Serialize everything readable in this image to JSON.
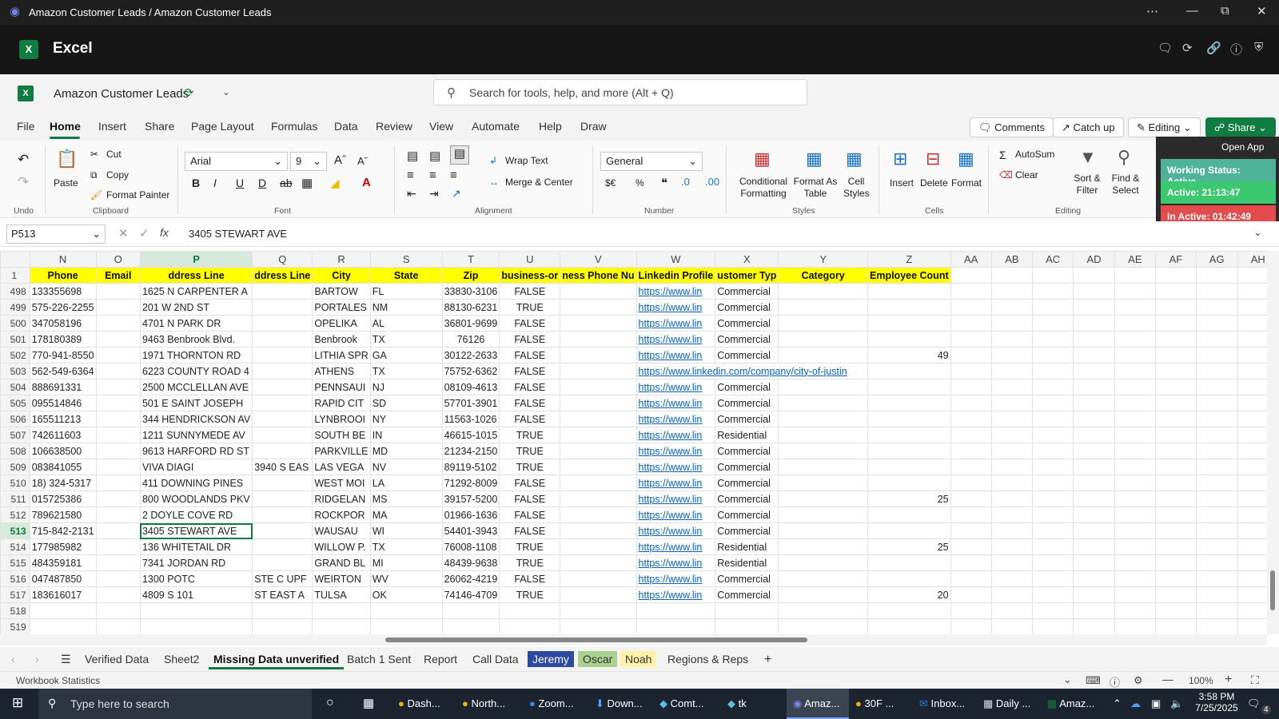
{
  "window": {
    "title": "Amazon Customer Leads / Amazon Customer Leads",
    "app_name": "Excel",
    "doc_name": "Amazon Customer Leads",
    "search_placeholder": "Search for tools, help, and more (Alt + Q)"
  },
  "menu": {
    "tabs": [
      "File",
      "Home",
      "Insert",
      "Share",
      "Page Layout",
      "Formulas",
      "Data",
      "Review",
      "View",
      "Automate",
      "Help",
      "Draw"
    ],
    "comments": "Comments",
    "catchup": "Catch up",
    "editing": "Editing",
    "share": "Share"
  },
  "ribbon": {
    "undo": "Undo",
    "clipboard": "Clipboard",
    "paste": "Paste",
    "cut": "Cut",
    "copy": "Copy",
    "format_painter": "Format Painter",
    "font": "Font",
    "font_name": "Arial",
    "font_size": "9",
    "alignment": "Alignment",
    "wrap_text": "Wrap Text",
    "merge_center": "Merge & Center",
    "number": "Number",
    "number_format": "General",
    "currency": "$€",
    "percent": "%",
    "styles": "Styles",
    "conditional_formatting": "Conditional Formatting",
    "format_as_table": "Format As Table",
    "cell_styles": "Cell Styles",
    "cells": "Cells",
    "insert": "Insert",
    "delete": "Delete",
    "format": "Format",
    "editing": "Editing",
    "autosum": "AutoSum",
    "clear": "Clear",
    "sort_filter": "Sort & Filter",
    "find_select": "Find & Select"
  },
  "overlay": {
    "open_app": "Open App",
    "working_status": "Working Status: Active",
    "active": "Active: 21:13:47",
    "inactive": "In Active: 01:42:49",
    "colors": {
      "working": "#4fb39a",
      "active": "#3cc870",
      "inactive": "#e24c4c"
    }
  },
  "formula": {
    "cell_ref": "P513",
    "fx": "fx",
    "value": "3405 STEWART AVE"
  },
  "grid": {
    "columns": [
      "N",
      "O",
      "P",
      "Q",
      "R",
      "S",
      "T",
      "U",
      "V",
      "W",
      "X",
      "Y",
      "Z",
      "AA",
      "AB",
      "AC",
      "AD",
      "AE",
      "AF",
      "AG",
      "AH"
    ],
    "header_row_num": "1",
    "headers": [
      "Phone",
      "Email",
      "ddress Line",
      "ddress Line",
      "City",
      "State",
      "Zip",
      "business-or",
      "ness Phone Nu",
      "Linkedin Profile",
      "ustomer Typ",
      "Category",
      "Employee Count"
    ],
    "rows": [
      {
        "n": "498",
        "phone": "133355698",
        "email": "",
        "addr1": "1625 N CARPENTER A",
        "addr2": "",
        "city": "BARTOW",
        "state": "FL",
        "zip": "33830-3106",
        "biz": "FALSE",
        "bphone": "",
        "li": "https://www.lin",
        "type": "Commercial",
        "cat": "",
        "emp": ""
      },
      {
        "n": "499",
        "phone": "575-226-2255",
        "email": "",
        "addr1": "201 W 2ND ST",
        "addr2": "",
        "city": "PORTALES",
        "state": "NM",
        "zip": "88130-6231",
        "biz": "TRUE",
        "bphone": "",
        "li": "https://www.lin",
        "type": "Commercial",
        "cat": "",
        "emp": ""
      },
      {
        "n": "500",
        "phone": "347058196",
        "email": "",
        "addr1": "4701 N PARK DR",
        "addr2": "",
        "city": "OPELIKA",
        "state": "AL",
        "zip": "36801-9699",
        "biz": "FALSE",
        "bphone": "",
        "li": "https://www.lin",
        "type": "Commercial",
        "cat": "",
        "emp": ""
      },
      {
        "n": "501",
        "phone": "178180389",
        "email": "",
        "addr1": "9463 Benbrook Blvd.",
        "addr2": "",
        "city": "Benbrook",
        "state": "TX",
        "zip": "76126",
        "biz": "FALSE",
        "bphone": "",
        "li": "https://www.lin",
        "type": "Commercial",
        "cat": "",
        "emp": ""
      },
      {
        "n": "502",
        "phone": "770-941-8550",
        "email": "",
        "addr1": "1971 THORNTON RD",
        "addr2": "",
        "city": "LITHIA SPR",
        "state": "GA",
        "zip": "30122-2633",
        "biz": "FALSE",
        "bphone": "",
        "li": "https://www.lin",
        "type": "Commercial",
        "cat": "",
        "emp": "49"
      },
      {
        "n": "503",
        "phone": "562-549-6364",
        "email": "",
        "addr1": "6223 COUNTY ROAD 4",
        "addr2": "",
        "city": "ATHENS",
        "state": "TX",
        "zip": "75752-6362",
        "biz": "FALSE",
        "bphone": "",
        "li": "https://www.linkedin.com/company/city-of-justin",
        "type": "",
        "cat": "",
        "emp": ""
      },
      {
        "n": "504",
        "phone": "888691331",
        "email": "",
        "addr1": "2500 MCCLELLAN AVE",
        "addr2": "",
        "city": "PENNSAUI",
        "state": "NJ",
        "zip": "08109-4613",
        "biz": "FALSE",
        "bphone": "",
        "li": "https://www.lin",
        "type": "Commercial",
        "cat": "",
        "emp": ""
      },
      {
        "n": "505",
        "phone": "095514846",
        "email": "",
        "addr1": "501 E SAINT JOSEPH",
        "addr2": "",
        "city": "RAPID CIT",
        "state": "SD",
        "zip": "57701-3901",
        "biz": "FALSE",
        "bphone": "",
        "li": "https://www.lin",
        "type": "Commercial",
        "cat": "",
        "emp": ""
      },
      {
        "n": "506",
        "phone": "165511213",
        "email": "",
        "addr1": "344 HENDRICKSON AV",
        "addr2": "",
        "city": "LYNBROOI",
        "state": "NY",
        "zip": "11563-1026",
        "biz": "FALSE",
        "bphone": "",
        "li": "https://www.lin",
        "type": "Commercial",
        "cat": "",
        "emp": ""
      },
      {
        "n": "507",
        "phone": "742611603",
        "email": "",
        "addr1": "1211 SUNNYMEDE AV",
        "addr2": "",
        "city": "SOUTH BE",
        "state": "IN",
        "zip": "46615-1015",
        "biz": "TRUE",
        "bphone": "",
        "li": "https://www.lin",
        "type": "Residential",
        "cat": "",
        "emp": ""
      },
      {
        "n": "508",
        "phone": "106638500",
        "email": "",
        "addr1": "9613 HARFORD RD ST",
        "addr2": "",
        "city": "PARKVILLE",
        "state": "MD",
        "zip": "21234-2150",
        "biz": "TRUE",
        "bphone": "",
        "li": "https://www.lin",
        "type": "Commercial",
        "cat": "",
        "emp": ""
      },
      {
        "n": "509",
        "phone": "083841055",
        "email": "",
        "addr1": "VIVA DIAGI",
        "addr2": "3940 S EAS",
        "city": "LAS VEGA",
        "state": "NV",
        "zip": "89119-5102",
        "biz": "TRUE",
        "bphone": "",
        "li": "https://www.lin",
        "type": "Commercial",
        "cat": "",
        "emp": ""
      },
      {
        "n": "510",
        "phone": "18) 324-5317",
        "email": "",
        "addr1": "411 DOWNING PINES",
        "addr2": "",
        "city": "WEST MOI",
        "state": "LA",
        "zip": "71292-8009",
        "biz": "FALSE",
        "bphone": "",
        "li": "https://www.lin",
        "type": "Commercial",
        "cat": "",
        "emp": ""
      },
      {
        "n": "511",
        "phone": "015725386",
        "email": "",
        "addr1": "800 WOODLANDS PKV",
        "addr2": "",
        "city": "RIDGELAN",
        "state": "MS",
        "zip": "39157-5200",
        "biz": "FALSE",
        "bphone": "",
        "li": "https://www.lin",
        "type": "Commercial",
        "cat": "",
        "emp": "25"
      },
      {
        "n": "512",
        "phone": "789621580",
        "email": "",
        "addr1": "2 DOYLE COVE RD",
        "addr2": "",
        "city": "ROCKPOR",
        "state": "MA",
        "zip": "01966-1636",
        "biz": "FALSE",
        "bphone": "",
        "li": "https://www.lin",
        "type": "Commercial",
        "cat": "",
        "emp": ""
      },
      {
        "n": "513",
        "phone": "715-842-2131",
        "email": "",
        "addr1": "3405 STEWART AVE",
        "addr2": "",
        "city": "WAUSAU",
        "state": "WI",
        "zip": "54401-3943",
        "biz": "FALSE",
        "bphone": "",
        "li": "https://www.lin",
        "type": "Commercial",
        "cat": "",
        "emp": ""
      },
      {
        "n": "514",
        "phone": "177985982",
        "email": "",
        "addr1": "136 WHITETAIL DR",
        "addr2": "",
        "city": "WILLOW P.",
        "state": "TX",
        "zip": "76008-1108",
        "biz": "TRUE",
        "bphone": "",
        "li": "https://www.lin",
        "type": "Residential",
        "cat": "",
        "emp": "25"
      },
      {
        "n": "515",
        "phone": "484359181",
        "email": "",
        "addr1": "7341 JORDAN RD",
        "addr2": "",
        "city": "GRAND BL",
        "state": "MI",
        "zip": "48439-9638",
        "biz": "TRUE",
        "bphone": "",
        "li": "https://www.lin",
        "type": "Residential",
        "cat": "",
        "emp": ""
      },
      {
        "n": "516",
        "phone": "047487850",
        "email": "",
        "addr1": "1300 POTC",
        "addr2": "STE C UPF",
        "city": "WEIRTON",
        "state": "WV",
        "zip": "26062-4219",
        "biz": "FALSE",
        "bphone": "",
        "li": "https://www.lin",
        "type": "Commercial",
        "cat": "",
        "emp": ""
      },
      {
        "n": "517",
        "phone": "183616017",
        "email": "",
        "addr1": "4809 S 101",
        "addr2": "ST EAST A",
        "city": "TULSA",
        "state": "OK",
        "zip": "74146-4709",
        "biz": "TRUE",
        "bphone": "",
        "li": "https://www.lin",
        "type": "Commercial",
        "cat": "",
        "emp": "20"
      },
      {
        "n": "518",
        "phone": "",
        "email": "",
        "addr1": "",
        "addr2": "",
        "city": "",
        "state": "",
        "zip": "",
        "biz": "",
        "bphone": "",
        "li": "",
        "type": "",
        "cat": "",
        "emp": ""
      },
      {
        "n": "519",
        "phone": "",
        "email": "",
        "addr1": "",
        "addr2": "",
        "city": "",
        "state": "",
        "zip": "",
        "biz": "",
        "bphone": "",
        "li": "",
        "type": "",
        "cat": "",
        "emp": ""
      }
    ]
  },
  "sheets": {
    "tabs": [
      "Verified Data",
      "Sheet2",
      "Missing Data unverified",
      "Batch 1 Sent",
      "Report",
      "Call Data",
      "Jeremy",
      "Oscar",
      "Noah",
      "Regions & Reps"
    ],
    "active": "Missing Data unverified",
    "colors": {
      "Jeremy": "#2b4aa0",
      "Oscar": "#a9d08e",
      "Noah": "#fff2a8"
    }
  },
  "status": {
    "left": "Workbook Statistics",
    "zoom": "100%"
  },
  "taskbar": {
    "search": "Type here to search",
    "apps": [
      "Dash...",
      "North...",
      "Zoom...",
      "Down...",
      "Comt...",
      "tk",
      "Amaz...",
      "30F ...",
      "Inbox...",
      "Daily ...",
      "Amaz..."
    ],
    "time": "3:58 PM",
    "date": "7/25/2025",
    "badge": "4"
  }
}
